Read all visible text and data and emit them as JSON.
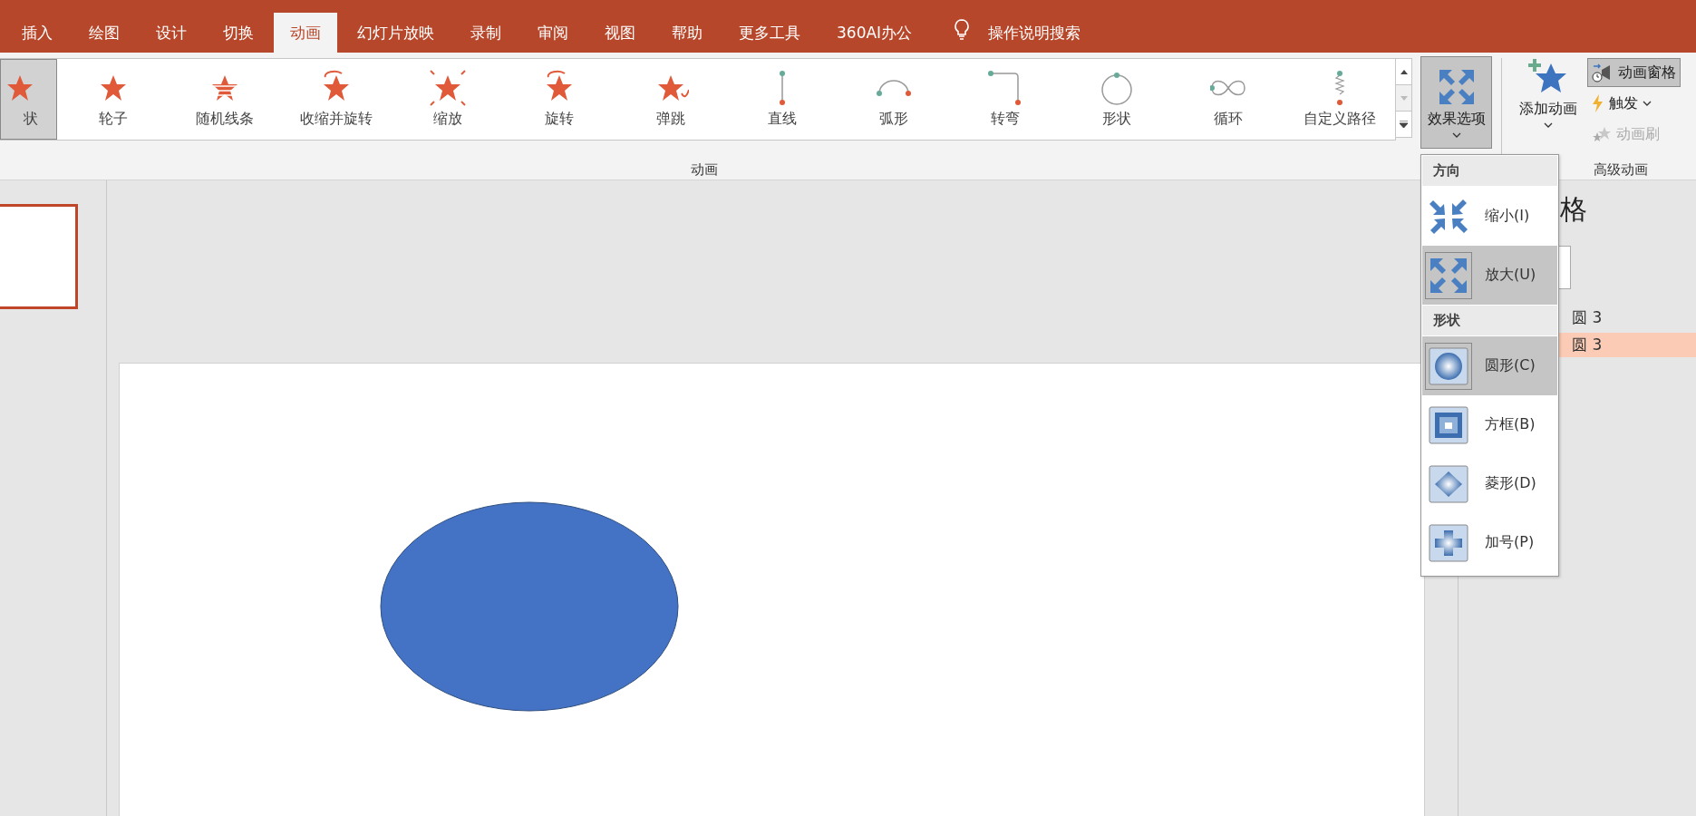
{
  "tabs": [
    {
      "label": "插入",
      "selected": false
    },
    {
      "label": "绘图",
      "selected": false
    },
    {
      "label": "设计",
      "selected": false
    },
    {
      "label": "切换",
      "selected": false
    },
    {
      "label": "动画",
      "selected": true
    },
    {
      "label": "幻灯片放映",
      "selected": false
    },
    {
      "label": "录制",
      "selected": false
    },
    {
      "label": "审阅",
      "selected": false
    },
    {
      "label": "视图",
      "selected": false
    },
    {
      "label": "帮助",
      "selected": false
    },
    {
      "label": "更多工具",
      "selected": false
    },
    {
      "label": "360AI办公",
      "selected": false
    }
  ],
  "tell_me": {
    "label": "操作说明搜索"
  },
  "gallery": {
    "label": "动画",
    "items": [
      {
        "label": "状",
        "kind": "emphasis",
        "selected": true
      },
      {
        "label": "轮子",
        "kind": "emphasis",
        "selected": false
      },
      {
        "label": "随机线条",
        "kind": "emphasis",
        "selected": false
      },
      {
        "label": "收缩并旋转",
        "kind": "emphasis",
        "selected": false
      },
      {
        "label": "缩放",
        "kind": "emphasis",
        "selected": false
      },
      {
        "label": "旋转",
        "kind": "emphasis",
        "selected": false
      },
      {
        "label": "弹跳",
        "kind": "emphasis",
        "selected": false
      },
      {
        "label": "直线",
        "kind": "path",
        "selected": false
      },
      {
        "label": "弧形",
        "kind": "path",
        "selected": false
      },
      {
        "label": "转弯",
        "kind": "path",
        "selected": false
      },
      {
        "label": "形状",
        "kind": "path",
        "selected": false
      },
      {
        "label": "循环",
        "kind": "path",
        "selected": false
      },
      {
        "label": "自定义路径",
        "kind": "path",
        "selected": false
      }
    ]
  },
  "effect_options": {
    "label": "效果选项",
    "selected": true
  },
  "advanced": {
    "label": "高级动画",
    "add_animation": "添加动画",
    "pane_button": {
      "label": "动画窗格",
      "selected": true
    },
    "trigger": {
      "label": "触发",
      "disabled": false
    },
    "painter": {
      "label": "动画刷",
      "disabled": true
    }
  },
  "dropdown": {
    "sections": [
      {
        "header": "方向",
        "items": [
          {
            "label": "缩小(I)",
            "selected": false
          },
          {
            "label": "放大(U)",
            "selected": true
          }
        ]
      },
      {
        "header": "形状",
        "items": [
          {
            "label": "圆形(C)",
            "selected": true
          },
          {
            "label": "方框(B)",
            "selected": false
          },
          {
            "label": "菱形(D)",
            "selected": false
          },
          {
            "label": "加号(P)",
            "selected": false
          }
        ]
      }
    ]
  },
  "pane": {
    "title": "格",
    "items": [
      {
        "label": "圆 3",
        "selected": false
      },
      {
        "label": "圆 3",
        "selected": true
      }
    ]
  }
}
